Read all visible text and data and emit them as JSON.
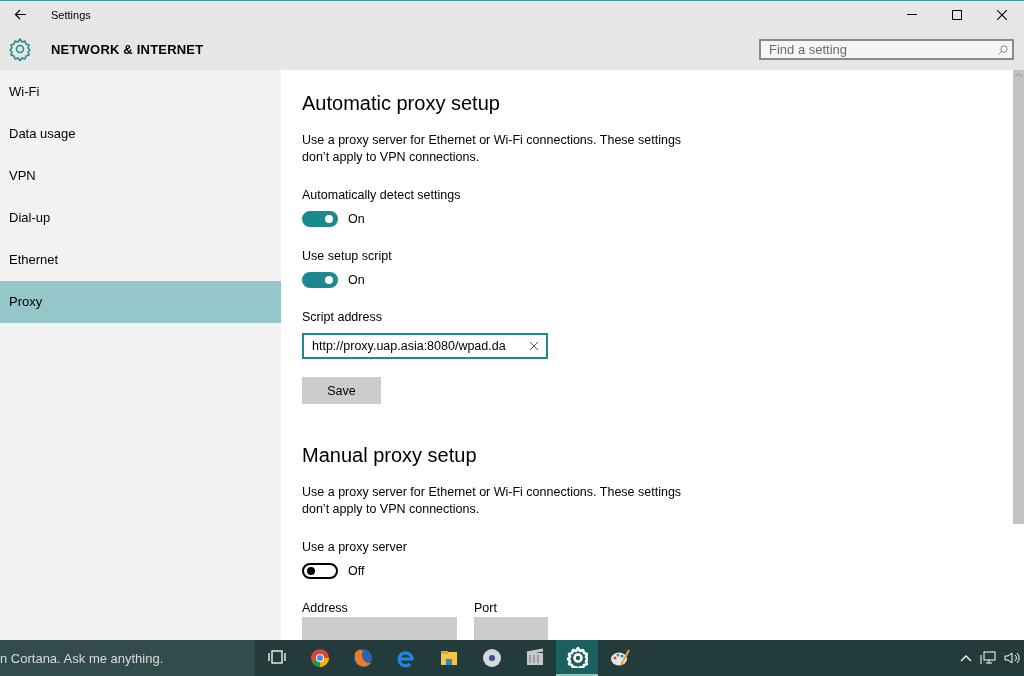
{
  "window": {
    "title": "Settings"
  },
  "header": {
    "title": "NETWORK & INTERNET",
    "search": {
      "placeholder": "Find a setting"
    }
  },
  "sidebar": {
    "items": [
      {
        "label": "Wi-Fi",
        "selected": false
      },
      {
        "label": "Data usage",
        "selected": false
      },
      {
        "label": "VPN",
        "selected": false
      },
      {
        "label": "Dial-up",
        "selected": false
      },
      {
        "label": "Ethernet",
        "selected": false
      },
      {
        "label": "Proxy",
        "selected": true
      }
    ]
  },
  "sections": [
    {
      "heading": "Automatic proxy setup",
      "description": "Use a proxy server for Ethernet or Wi-Fi connections. These settings don’t apply to VPN connections.",
      "controls": [
        {
          "kind": "toggle",
          "label": "Automatically detect settings",
          "on": true,
          "state_text": "On"
        },
        {
          "kind": "toggle",
          "label": "Use setup script",
          "on": true,
          "state_text": "On"
        },
        {
          "kind": "field",
          "label": "Script address",
          "value": "http://proxy.uap.asia:8080/wpad.da"
        },
        {
          "kind": "button",
          "label": "Save"
        }
      ]
    },
    {
      "heading": "Manual proxy setup",
      "description": "Use a proxy server for Ethernet or Wi-Fi connections. These settings don’t apply to VPN connections.",
      "controls": [
        {
          "kind": "toggle",
          "label": "Use a proxy server",
          "on": false,
          "state_text": "Off"
        },
        {
          "kind": "field_pair",
          "fields": [
            {
              "label": "Address"
            },
            {
              "label": "Port"
            }
          ]
        }
      ]
    }
  ],
  "taskbar": {
    "search_text": "n Cortana. Ask me anything.",
    "apps": [
      {
        "kind": "taskview",
        "selected": false
      },
      {
        "kind": "ring",
        "selected": false
      },
      {
        "kind": "fox",
        "selected": false
      },
      {
        "kind": "e",
        "selected": false
      },
      {
        "kind": "folder",
        "selected": false
      },
      {
        "kind": "disc",
        "selected": false
      },
      {
        "kind": "film",
        "selected": false
      },
      {
        "kind": "gear",
        "selected": true
      },
      {
        "kind": "palette",
        "selected": false
      }
    ]
  }
}
